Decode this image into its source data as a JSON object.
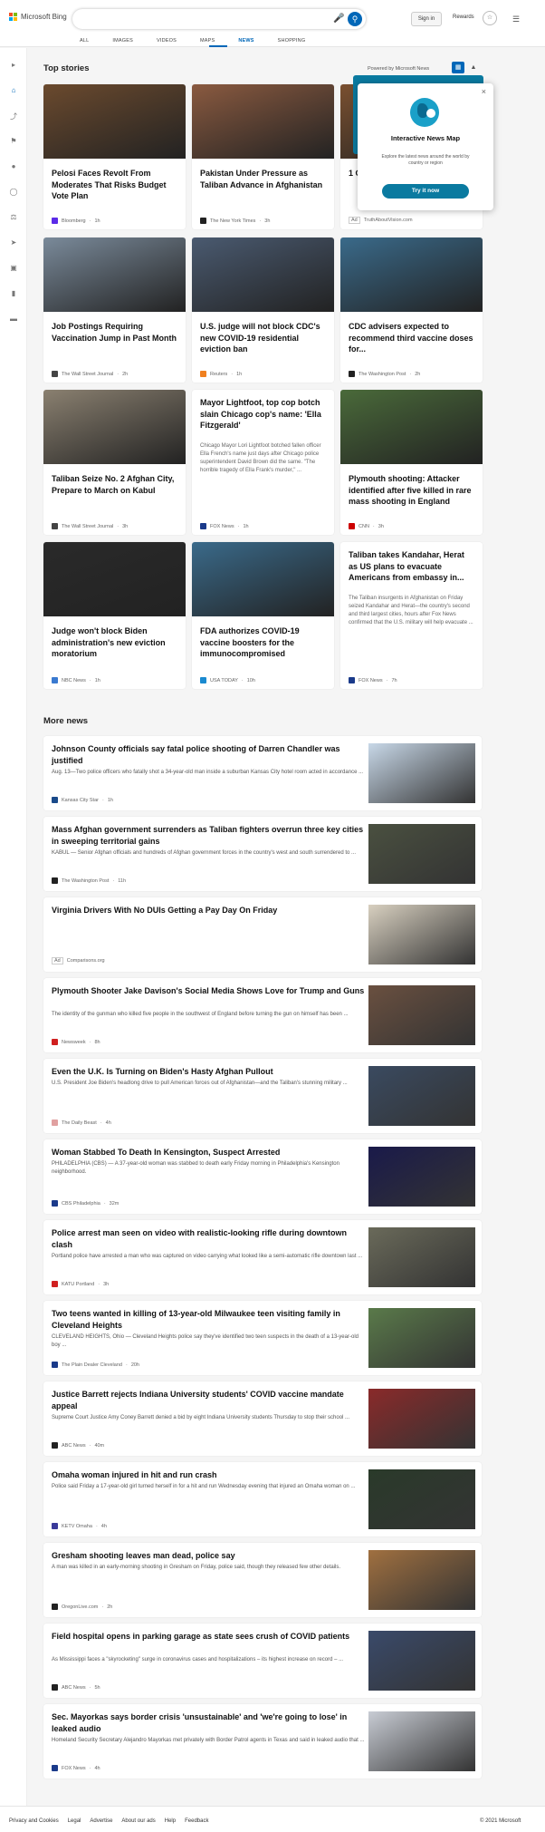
{
  "header": {
    "brand": "Microsoft Bing",
    "signin": "Sign in",
    "rewards": "Rewards",
    "tabs": [
      "ALL",
      "IMAGES",
      "VIDEOS",
      "MAPS",
      "NEWS",
      "SHOPPING"
    ]
  },
  "top_stories": {
    "title": "Top stories",
    "powered_by": "Powered by Microsoft News",
    "cards": [
      {
        "title": "Pelosi Faces Revolt From Moderates That Risks Budget Vote Plan",
        "source": "Bloomberg",
        "age": "1h",
        "color": "#6b4a2e",
        "icon": "#5b2be8"
      },
      {
        "title": "Pakistan Under Pressure as Taliban Advance in Afghanistan",
        "source": "The New York Times",
        "age": "3h",
        "color": "#8a5a40",
        "icon": "#222"
      },
      {
        "title": "1 Odd... To Pe...",
        "source": "TruthAboutVision.com",
        "age": "Ad",
        "color": "#7a5030",
        "icon": "#999"
      },
      {
        "title": "Job Postings Requiring Vaccination Jump in Past Month",
        "source": "The Wall Street Journal",
        "age": "2h",
        "color": "#7a8a9a",
        "icon": "#444"
      },
      {
        "title": "U.S. judge will not block CDC's new COVID-19 residential eviction ban",
        "source": "Reuters",
        "age": "1h",
        "color": "#4a5a70",
        "icon": "#f08020"
      },
      {
        "title": "CDC advisers expected to recommend third vaccine doses for...",
        "source": "The Washington Post",
        "age": "2h",
        "color": "#3a6a8a",
        "icon": "#222"
      },
      {
        "title": "Taliban Seize No. 2 Afghan City, Prepare to March on Kabul",
        "source": "The Wall Street Journal",
        "age": "3h",
        "color": "#8a8070",
        "icon": "#444"
      },
      {
        "title": "Mayor Lightfoot, top cop botch slain Chicago cop's name: 'Ella Fitzgerald'",
        "desc": "Chicago Mayor Lori Lightfoot botched fallen officer Ella French's name just days after Chicago police superintendent David Brown did the same. \"The horrible tragedy of Ella Frank's murder,\" ...",
        "source": "FOX News",
        "age": "1h",
        "color": "",
        "icon": "#1a3a8a"
      },
      {
        "title": "Plymouth shooting: Attacker identified after five killed in rare mass shooting in England",
        "source": "CNN",
        "age": "3h",
        "color": "#4a6a3a",
        "icon": "#cc0000"
      },
      {
        "title": "Judge won't block Biden administration's new eviction moratorium",
        "source": "NBC News",
        "age": "1h",
        "color": "#2a2a2a",
        "icon": "#3a7ad0"
      },
      {
        "title": "FDA authorizes COVID-19 vaccine boosters for the immunocompromised",
        "source": "USA TODAY",
        "age": "10h",
        "color": "#3a6a8a",
        "icon": "#1a8ad0"
      },
      {
        "title": "Taliban takes Kandahar, Herat as US plans to evacuate Americans from embassy in...",
        "desc": "The Taliban insurgents in Afghanistan on Friday seized Kandahar and Herat—the country's second and third largest cities, hours after Fox News confirmed that the U.S. military will help evacuate ...",
        "source": "FOX News",
        "age": "7h",
        "color": "",
        "icon": "#1a3a8a"
      }
    ]
  },
  "popup": {
    "title": "Interactive News Map",
    "desc": "Explore the latest news around the world by country or region",
    "button": "Try it now"
  },
  "more_news": {
    "title": "More news",
    "items": [
      {
        "title": "Johnson County officials say fatal police shooting of Darren Chandler was justified",
        "desc": "Aug. 13—Two police officers who fatally shot a 34-year-old man inside a suburban Kansas City hotel room acted in accordance ...",
        "source": "Kansas City Star",
        "age": "1h",
        "color": "#c8d8e8",
        "icon": "#1a4a8a"
      },
      {
        "title": "Mass Afghan government surrenders as Taliban fighters overrun three key cities in sweeping territorial gains",
        "desc": "KABUL — Senior Afghan officials and hundreds of Afghan government forces in the country's west and south surrendered to ...",
        "source": "The Washington Post",
        "age": "11h",
        "color": "#4a5040",
        "icon": "#222"
      },
      {
        "title": "Virginia Drivers With No DUIs Getting a Pay Day On Friday",
        "desc": "",
        "source": "Comparisons.org",
        "age": "Ad",
        "color": "#d8d0c0",
        "icon": "#999"
      },
      {
        "title": "Plymouth Shooter Jake Davison's Social Media Shows Love for Trump and Guns",
        "desc": "The identity of the gunman who killed five people in the southwest of England before turning the gun on himself has been ...",
        "source": "Newsweek",
        "age": "8h",
        "color": "#6a5040",
        "icon": "#d02020"
      },
      {
        "title": "Even the U.K. Is Turning on Biden's Hasty Afghan Pullout",
        "desc": "U.S. President Joe Biden's headlong drive to pull American forces out of Afghanistan—and the Taliban's stunning military ...",
        "source": "The Daily Beast",
        "age": "4h",
        "color": "#3a4a60",
        "icon": "#e0a0a0"
      },
      {
        "title": "Woman Stabbed To Death In Kensington, Suspect Arrested",
        "desc": "PHILADELPHIA (CBS) — A 37-year-old woman was stabbed to death early Friday morning in Philadelphia's Kensington neighborhood.",
        "source": "CBS Philadelphia",
        "age": "32m",
        "color": "#1a1a4a",
        "icon": "#1a3a8a"
      },
      {
        "title": "Police arrest man seen on video with realistic-looking rifle during downtown clash",
        "desc": "Portland police have arrested a man who was captured on video carrying what looked like a semi-automatic rifle downtown last ...",
        "source": "KATU Portland",
        "age": "3h",
        "color": "#6a6a5a",
        "icon": "#d02020"
      },
      {
        "title": "Two teens wanted in killing of 13-year-old Milwaukee teen visiting family in Cleveland Heights",
        "desc": "CLEVELAND HEIGHTS, Ohio — Cleveland Heights police say they've identified two teen suspects in the death of a 13-year-old boy ...",
        "source": "The Plain Dealer Cleveland",
        "age": "20h",
        "color": "#5a7a4a",
        "icon": "#1a3a8a"
      },
      {
        "title": "Justice Barrett rejects Indiana University students' COVID vaccine mandate appeal",
        "desc": "Supreme Court Justice Amy Coney Barrett denied a bid by eight Indiana University students Thursday to stop their school ...",
        "source": "ABC News",
        "age": "40m",
        "color": "#8a2a2a",
        "icon": "#222"
      },
      {
        "title": "Omaha woman injured in hit and run crash",
        "desc": "Police said Friday a 17-year-old girl turned herself in for a hit and run Wednesday evening that injured an Omaha woman on ...",
        "source": "KETV Omaha",
        "age": "4h",
        "color": "#2a3a2a",
        "icon": "#3a3a9a"
      },
      {
        "title": "Gresham shooting leaves man dead, police say",
        "desc": "A man was killed in an early-morning shooting in Gresham on Friday, police said, though they released few other details.",
        "source": "OregonLive.com",
        "age": "2h",
        "color": "#a07040",
        "icon": "#222"
      },
      {
        "title": "Field hospital opens in parking garage as state sees crush of COVID patients",
        "desc": "As Mississippi faces a \"skyrocketing\" surge in coronavirus cases and hospitalizations – its highest increase on record – ...",
        "source": "ABC News",
        "age": "5h",
        "color": "#3a4a6a",
        "icon": "#222"
      },
      {
        "title": "Sec. Mayorkas says border crisis 'unsustainable' and 'we're going to lose' in leaked audio",
        "desc": "Homeland Security Secretary Alejandro Mayorkas met privately with Border Patrol agents in Texas and said in leaked audio that ...",
        "source": "FOX News",
        "age": "4h",
        "color": "#c8ccd4",
        "icon": "#1a3a8a"
      }
    ]
  },
  "footer": {
    "links": [
      "Privacy and Cookies",
      "Legal",
      "Advertise",
      "About our ads",
      "Help",
      "Feedback"
    ],
    "copyright": "© 2021 Microsoft"
  }
}
